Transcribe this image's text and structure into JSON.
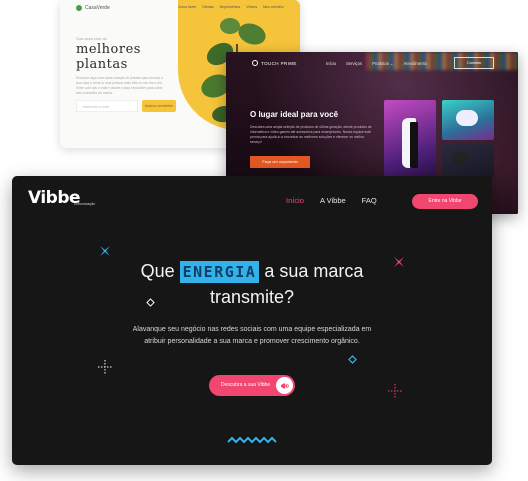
{
  "plants_site": {
    "brand": "CasaVerde",
    "nav": [
      "Como fazer",
      "Ofertas",
      "Depoimentos",
      "Vídeos",
      "Meu carrinho"
    ],
    "kicker": "Sua casa com as",
    "title_line1": "melhores",
    "title_line2": "plantas",
    "description": "Encontre aqui uma vasta seleção de plantas para decorar a sua casa e torná-lo uma pessoa mais feliz no seu dia a dia. Entre com seu e-mail e assine nossa newsletter para saber das novidades da marca.",
    "email_placeholder": "Insira seu e-mail",
    "subscribe_label": "Assinar newsletter",
    "accent_color": "#f5c43a"
  },
  "electronics_site": {
    "brand": "TOUCH PRIME",
    "nav": [
      "Início",
      "Serviços",
      "Produtos ⌄",
      "Atendimento"
    ],
    "contact_label": "Contato",
    "title": "O lugar ideal para você",
    "description": "Descubra uma ampla seleção de produtos de última geração, desde produtos de informática e vídeo games até acessórios para smartphones. Nossa equipe está pronta para ajudá-lo a encontrar as melhores soluções e oferecer os melhor serviço!",
    "cta_label": "Faça um orçamento",
    "accent_color": "#e25823"
  },
  "vibbe_site": {
    "logo": "Vibbe",
    "logo_sub": "comunicação",
    "nav": {
      "home": "Início",
      "about": "A Vibbe",
      "faq": "FAQ"
    },
    "enter_label": "Entre na Vibbe",
    "headline_before": "Que",
    "headline_highlight": "ENERGIA",
    "headline_after": "a sua marca",
    "headline_line2": "transmite?",
    "subheadline_line1": "Alavanque seu negócio nas redes sociais com uma equipe especializada em",
    "subheadline_line2": "atribuir personalidade a sua marca e promover crescimento orgânico.",
    "cta_label": "Descubra a sua Vibbe",
    "accent_color": "#f0466f",
    "highlight_color": "#33b2ea"
  }
}
